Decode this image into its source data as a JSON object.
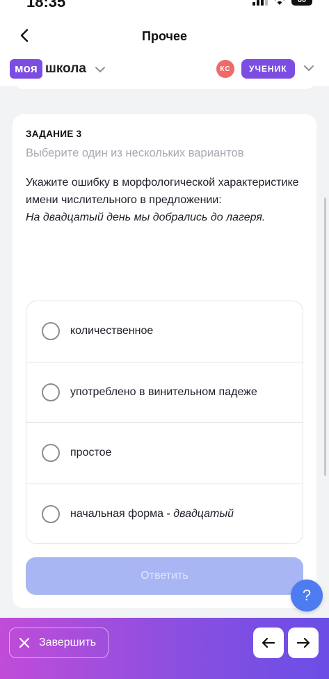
{
  "status_bar": {
    "time": "18:35",
    "battery": "60"
  },
  "header": {
    "back_icon": "chevron-left-icon",
    "title": "Прочее",
    "brand_part1": "моя",
    "brand_part2": "школа",
    "avatar_initials": "КС",
    "role": "УЧЕНИК",
    "colors": {
      "brand_purple": "#7b4de2",
      "avatar": "#f06a6a"
    }
  },
  "task": {
    "title": "ЗАДАНИЕ 3",
    "hint": "Выберите один из нескольких вариантов",
    "question": "Укажите ошибку в морфологической характеристике имени числительного в предложении:",
    "sentence": "На двадцатый день мы добрались до лагеря.",
    "options": [
      {
        "label": "количественное",
        "label_italic": "",
        "selected": false
      },
      {
        "label": "употреблено в винительном падеже",
        "label_italic": "",
        "selected": false
      },
      {
        "label": "простое",
        "label_italic": "",
        "selected": false
      },
      {
        "label": "начальная форма - ",
        "label_italic": "двадцатый",
        "selected": false
      }
    ],
    "answer_button": "Ответить"
  },
  "help_button": "?",
  "bottom_bar": {
    "finish_label": "Завершить",
    "prev_icon": "arrow-left-icon",
    "next_icon": "arrow-right-icon"
  }
}
